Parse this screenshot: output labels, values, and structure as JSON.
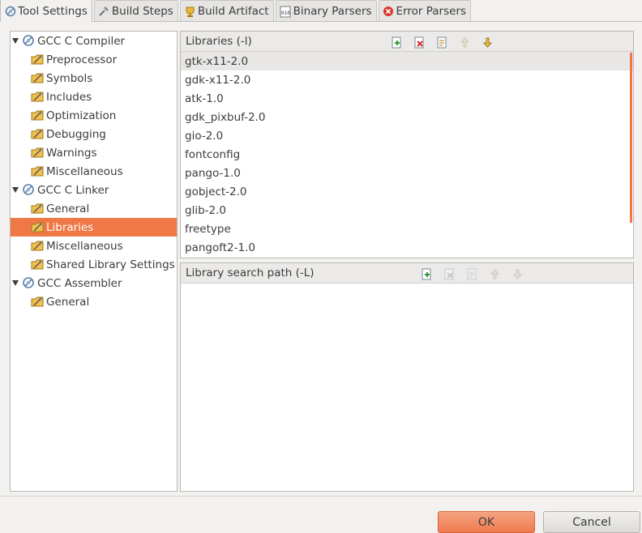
{
  "tabs": [
    {
      "label": "Tool Settings",
      "icon": "tool-settings-icon",
      "active": true
    },
    {
      "label": "Build Steps",
      "icon": "build-steps-icon"
    },
    {
      "label": "Build Artifact",
      "icon": "build-artifact-icon"
    },
    {
      "label": "Binary Parsers",
      "icon": "binary-parsers-icon"
    },
    {
      "label": "Error Parsers",
      "icon": "error-parsers-icon"
    }
  ],
  "tree": {
    "compiler": {
      "label": "GCC C Compiler",
      "children": [
        "Preprocessor",
        "Symbols",
        "Includes",
        "Optimization",
        "Debugging",
        "Warnings",
        "Miscellaneous"
      ]
    },
    "linker": {
      "label": "GCC C Linker",
      "children": [
        "General",
        "Libraries",
        "Miscellaneous",
        "Shared Library Settings"
      ],
      "selected": "Libraries"
    },
    "assembler": {
      "label": "GCC Assembler",
      "children": [
        "General"
      ]
    }
  },
  "libraries": {
    "title": "Libraries (-l)",
    "items": [
      "gtk-x11-2.0",
      "gdk-x11-2.0",
      "atk-1.0",
      "gdk_pixbuf-2.0",
      "gio-2.0",
      "fontconfig",
      "pango-1.0",
      "gobject-2.0",
      "glib-2.0",
      "freetype",
      "pangoft2-1.0"
    ],
    "selected": "gtk-x11-2.0"
  },
  "search_path": {
    "title": "Library search path (-L)",
    "items": []
  },
  "buttons": {
    "ok": "OK",
    "cancel": "Cancel"
  },
  "colors": {
    "accent": "#f07746",
    "selection_bg": "#e8e7e5"
  }
}
